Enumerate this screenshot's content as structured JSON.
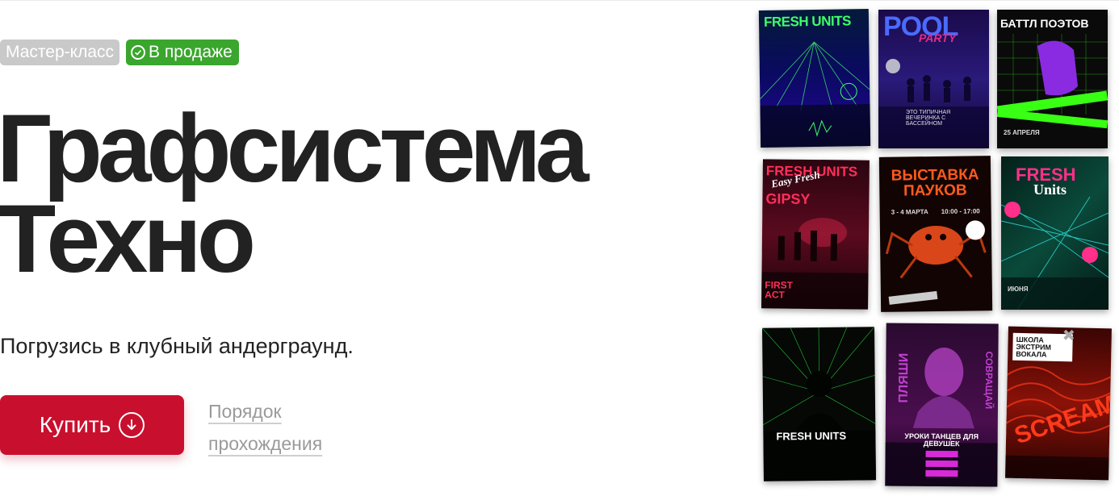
{
  "tags": {
    "category": "Мастер-класс",
    "status": "В продаже"
  },
  "title": {
    "line1": "Графсистема",
    "line2": "Техно"
  },
  "subtitle": "Погрузись в клубный андерграунд.",
  "buy_button": {
    "label": "Купить",
    "icon": "arrow-down-circle-icon"
  },
  "order_link": {
    "line1": "Порядок",
    "line2": "прохождения"
  },
  "colors": {
    "accent_red": "#c8102e",
    "status_green": "#3aa62d",
    "tag_grey": "#c9c9c9"
  },
  "posters": [
    {
      "name": "fresh-units-laser",
      "title": "FRESH UNITS"
    },
    {
      "name": "pool-party",
      "title": "POOL",
      "sub": "PARTY",
      "caption": "ЭТО ТИПИЧНАЯ ВЕЧЕРИНКА С БАССЕЙНОМ"
    },
    {
      "name": "battle-poets",
      "title": "БАТТЛ ПОЭТОВ",
      "date": "25 АПРЕЛЯ"
    },
    {
      "name": "fresh-units-gipsy",
      "title": "FRESH UNITS",
      "script": "Easy Fresh",
      "sub": "GIPSY",
      "footer": "FIRST ACT"
    },
    {
      "name": "spider-exhibition",
      "title": "ВЫСТАВКА ПАУКОВ",
      "date": "3 - 4 МАРТА",
      "time": "10:00 - 17:00"
    },
    {
      "name": "fresh-units-act",
      "title": "FRESH",
      "script": "Units",
      "date": "ИЮНЯ"
    },
    {
      "name": "fresh-units-silhouette",
      "title": "FRESH UNITS"
    },
    {
      "name": "dance-lessons",
      "title": "УРОКИ ТАНЦЕВ ДЛЯ ДЕВУШЕК",
      "side1": "ПЛЯШИ",
      "side2": "СОВРАЩАЙ"
    },
    {
      "name": "extreme-vocal",
      "title": "ШКОЛА ЭКСТРИМ ВОКАЛА",
      "big": "SCREAM"
    }
  ]
}
